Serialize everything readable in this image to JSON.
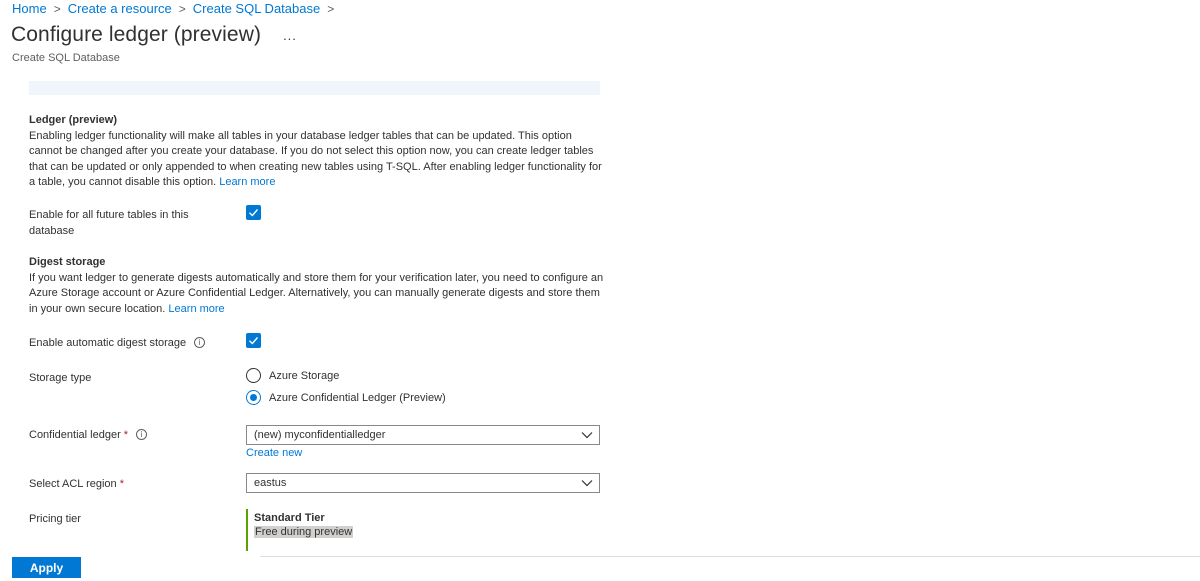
{
  "breadcrumb": {
    "items": [
      "Home",
      "Create a resource",
      "Create SQL Database"
    ],
    "separator": ">"
  },
  "header": {
    "title": "Configure ledger (preview)",
    "more": "...",
    "subtitle": "Create SQL Database"
  },
  "ledger": {
    "heading": "Ledger (preview)",
    "description": "Enabling ledger functionality will make all tables in your database ledger tables that can be updated. This option cannot be changed after you create your database. If you do not select this option now, you can create ledger tables that can be updated or only appended to when creating new tables using T-SQL. After enabling ledger functionality for a table, you cannot disable this option.",
    "learn_more": "Learn more",
    "enable_label": "Enable for all future tables in this database",
    "enable_checked": true
  },
  "digest": {
    "heading": "Digest storage",
    "description": "If you want ledger to generate digests automatically and store them for your verification later, you need to configure an Azure Storage account or Azure Confidential Ledger. Alternatively, you can manually generate digests and store them in your own secure location.",
    "learn_more": "Learn more",
    "auto_label": "Enable automatic digest storage",
    "auto_checked": true,
    "storage_type_label": "Storage type",
    "storage_options": [
      "Azure Storage",
      "Azure Confidential Ledger (Preview)"
    ],
    "storage_selected": "Azure Confidential Ledger (Preview)",
    "confidential_ledger_label": "Confidential ledger",
    "required_mark": "*",
    "confidential_ledger_value": "(new) myconfidentialledger",
    "create_new": "Create new",
    "acl_region_label": "Select ACL region",
    "acl_region_value": "eastus",
    "pricing_label": "Pricing tier",
    "pricing_tier_name": "Standard Tier",
    "pricing_tier_desc": "Free during preview"
  },
  "footer": {
    "apply_label": "Apply"
  },
  "colors": {
    "accent": "#0078d4",
    "required": "#a4262c",
    "tier_bar": "#57a300"
  }
}
